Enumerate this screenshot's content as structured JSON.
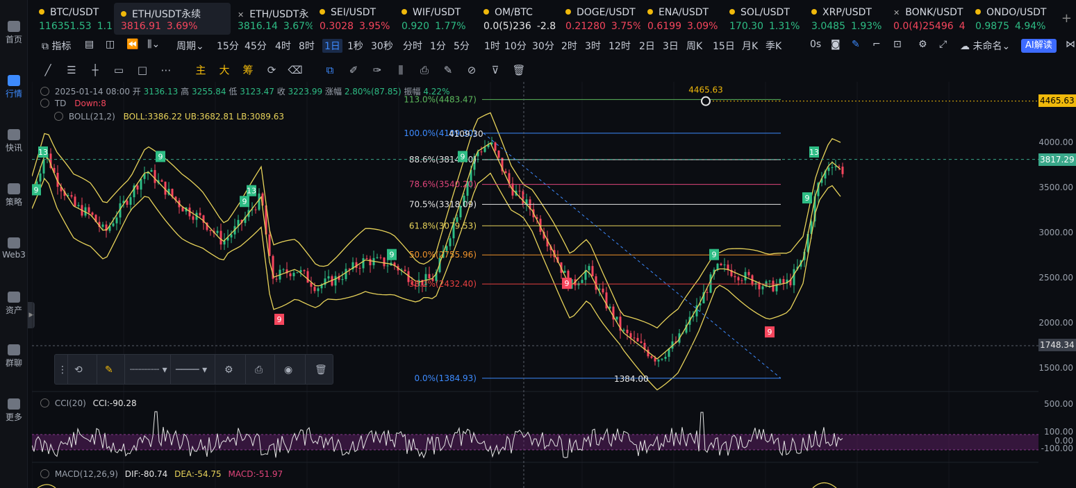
{
  "sidebar": {
    "items": [
      {
        "label": "首页",
        "active": false
      },
      {
        "label": "行情",
        "active": true
      },
      {
        "label": "快讯",
        "active": false
      },
      {
        "label": "策略",
        "active": false
      },
      {
        "label": "Web3",
        "active": false
      },
      {
        "label": "资产",
        "active": false
      },
      {
        "label": "群聊",
        "active": false
      },
      {
        "label": "更多",
        "active": false
      }
    ]
  },
  "tickers": [
    {
      "name": "BTC/USDT",
      "price": "116351.53",
      "change": "1.1",
      "dir": "up",
      "icon": "dot"
    },
    {
      "name": "ETH/USDT永续",
      "price": "3816.91",
      "change": "3.69%",
      "dir": "down",
      "icon": "binance",
      "active": true
    },
    {
      "name": "ETH/USDT永",
      "price": "3816.14",
      "change": "3.67%",
      "dir": "up",
      "icon": "x"
    },
    {
      "name": "SEI/USDT",
      "price": "0.3028",
      "change": "3.95%",
      "dir": "down",
      "icon": "dot"
    },
    {
      "name": "WIF/USDT",
      "price": "0.920",
      "change": "1.77%",
      "dir": "up",
      "icon": "dot"
    },
    {
      "name": "OM/BTC",
      "price": "0.0(5)236",
      "change": "-2.8",
      "dir": "neutral",
      "icon": "dot"
    },
    {
      "name": "DOGE/USDT",
      "price": "0.21280",
      "change": "3.75%",
      "dir": "down",
      "icon": "dot"
    },
    {
      "name": "ENA/USDT",
      "price": "0.6199",
      "change": "3.09%",
      "dir": "down",
      "icon": "dot"
    },
    {
      "name": "SOL/USDT",
      "price": "170.30",
      "change": "1.31%",
      "dir": "up",
      "icon": "dot"
    },
    {
      "name": "XRP/USDT",
      "price": "3.0485",
      "change": "1.93%",
      "dir": "up",
      "icon": "dot"
    },
    {
      "name": "BONK/USDT",
      "price": "0.0(4)25496",
      "change": "4",
      "dir": "down",
      "icon": "x"
    },
    {
      "name": "ONDO/USDT",
      "price": "0.9875",
      "change": "4.94%",
      "dir": "up",
      "icon": "dot"
    }
  ],
  "toolbar": {
    "indicators_label": "指标",
    "period_label": "周期",
    "timeframes": [
      "15分",
      "45分",
      "4时",
      "8时",
      "1日",
      "1秒",
      "30秒",
      "分时",
      "1分",
      "5分",
      "1时",
      "10分",
      "30分",
      "2时",
      "3时",
      "12时",
      "2日",
      "3日",
      "周K",
      "15日",
      "月K",
      "季K"
    ],
    "selected_timeframe": "1日",
    "countdown": "0s",
    "layout_name": "未命名",
    "ai_label": "AI解读"
  },
  "drawtools": {
    "text_tools": [
      "主",
      "大",
      "筹"
    ]
  },
  "ohlc": {
    "date": "2025-01-14 08:00",
    "open_label": "开",
    "open": "3136.13",
    "high_label": "高",
    "high": "3255.84",
    "low_label": "低",
    "low": "3123.47",
    "close_label": "收",
    "close": "3223.99",
    "chg_label": "涨幅",
    "chg": "2.80%(87.85)",
    "amp_label": "振幅",
    "amp": "4.22%"
  },
  "td": {
    "name": "TD",
    "value": "Down:8"
  },
  "boll": {
    "name": "BOLL(21,2)",
    "boll": "BOLL:3386.22",
    "ub": "UB:3682.81",
    "lb": "LB:3089.63"
  },
  "cci": {
    "name": "CCI(20)",
    "value": "CCI:-90.28"
  },
  "macd": {
    "name": "MACD(12,26,9)",
    "dif": "DIF:-80.74",
    "dea": "DEA:-54.75",
    "macd": "MACD:-51.97"
  },
  "fib_levels": [
    {
      "label": "113.0%(4483.47)",
      "price": 4483.47,
      "color": "#5cb85c"
    },
    {
      "label": "100.0%(4109.30)",
      "price": 4109.3,
      "color": "#3d8bff"
    },
    {
      "label": "88.6%(3814.40)",
      "price": 3814.4,
      "color": "#e6e6e6"
    },
    {
      "label": "78.6%(3540.20)",
      "price": 3540.2,
      "color": "#e0457b"
    },
    {
      "label": "70.5%(3318.09)",
      "price": 3318.09,
      "color": "#e6e6e6"
    },
    {
      "label": "61.8%(3079.53)",
      "price": 3079.53,
      "color": "#e8d35a"
    },
    {
      "label": "50.0%(2755.96)",
      "price": 2755.96,
      "color": "#f0932b"
    },
    {
      "label": "38.2%(2432.40)",
      "price": 2432.4,
      "color": "#e84040"
    },
    {
      "label": "0.0%(1384.93)",
      "price": 1384.93,
      "color": "#3d8bff"
    }
  ],
  "annotations": {
    "top_price": "4465.63",
    "top_value": "4109.30",
    "low_value": "1384.00"
  },
  "price_axis": {
    "ticks": [
      "4000.00",
      "3500.00",
      "3000.00",
      "2500.00",
      "2000.00",
      "1500.00"
    ],
    "current_tag": "3817.29",
    "top_tag": "4465.63",
    "cross_tag": "1748.34",
    "cci_ticks": [
      "500.00",
      "100.00",
      "0.00",
      "-100.00"
    ]
  },
  "td_markers": [
    "13",
    "9",
    "9",
    "9",
    "13",
    "9",
    "9",
    "9",
    "9",
    "9",
    "13",
    "9",
    "9"
  ],
  "colors": {
    "up": "#2ebd85",
    "down": "#f6465d",
    "boll": "#e8d35a",
    "accent": "#3d8bff"
  }
}
